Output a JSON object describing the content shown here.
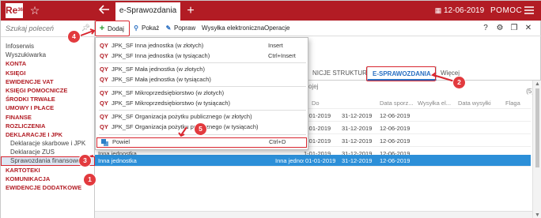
{
  "titlebar": {
    "logo": "Re",
    "logo_sup": "360",
    "active_tab": "e-Sprawozdania",
    "date": "12-06-2019",
    "help": "POMOC"
  },
  "sidebar": {
    "search_placeholder": "Szukaj poleceń",
    "items": [
      {
        "label": "Infoserwis",
        "style": "plain"
      },
      {
        "label": "Wyszukiwarka",
        "style": "plain"
      },
      {
        "label": "KONTA",
        "style": "red"
      },
      {
        "label": "KSIĘGI",
        "style": "red"
      },
      {
        "label": "EWIDENCJE VAT",
        "style": "red"
      },
      {
        "label": "KSIĘGI POMOCNICZE",
        "style": "red"
      },
      {
        "label": "ŚRODKI TRWAŁE",
        "style": "red"
      },
      {
        "label": "UMOWY I PŁACE",
        "style": "red"
      },
      {
        "label": "FINANSE",
        "style": "red"
      },
      {
        "label": "ROZLICZENIA",
        "style": "red"
      },
      {
        "label": "DEKLARACJE I JPK",
        "style": "red"
      },
      {
        "label": "Deklaracje skarbowe i JPK",
        "style": "sub"
      },
      {
        "label": "Deklaracje ZUS",
        "style": "sub"
      },
      {
        "label": "Sprawozdania finansowe",
        "style": "sub-sel"
      },
      {
        "label": "KARTOTEKI",
        "style": "red"
      },
      {
        "label": "KOMUNIKACJA",
        "style": "red"
      },
      {
        "label": "EWIDENCJE DODATKOWE",
        "style": "red"
      }
    ]
  },
  "toolbar": {
    "add": "Dodaj",
    "show": "Pokaż",
    "edit": "Popraw",
    "send": "Wysyłka elektroniczna",
    "ops": "Operacje",
    "help_icon": "?"
  },
  "tabs": {
    "structures": "NICJE STRUKTUR",
    "esprawozdania": "E-SPRAWOZDANIA",
    "more": "Więcej",
    "filter_fragment": "ojej",
    "count": "(5)"
  },
  "grid": {
    "headers": [
      "",
      "",
      "Do",
      "Data sporz...",
      "Wysyłka el...",
      "Data wysyłki",
      "Flaga"
    ],
    "rows": [
      {
        "a": "",
        "b": "1-01-2019",
        "do": "31-12-2019",
        "date": "12-06-2019",
        "selected": false
      },
      {
        "a": "",
        "b": "1-01-2019",
        "do": "31-12-2019",
        "date": "12-06-2019",
        "selected": false
      },
      {
        "a": "",
        "b": "1-01-2019",
        "do": "31-12-2019",
        "date": "12-06-2019",
        "selected": false
      },
      {
        "a": "Inna jednostka",
        "b": "1-01-2019",
        "do": "31-12-2019",
        "date": "12-06-2019",
        "selected": false
      },
      {
        "a": "Inna jednostka",
        "b": "Inna jednos...",
        "c": "01-01-2019",
        "do": "31-12-2019",
        "date": "12-06-2019",
        "selected": true
      }
    ]
  },
  "menu": {
    "items": [
      {
        "qy": "QY",
        "label": "JPK_SF Inna jednostka (w złotych)",
        "shortcut": "Insert"
      },
      {
        "qy": "QY",
        "label": "JPK_SF Inna jednostka (w tysiącach)",
        "shortcut": "Ctrl+Insert"
      },
      {
        "qy": "QY",
        "label": "JPK_SF Mała jednostka (w złotych)",
        "shortcut": ""
      },
      {
        "qy": "QY",
        "label": "JPK_SF Mała jednostka (w tysiącach)",
        "shortcut": ""
      },
      {
        "qy": "QY",
        "label": "JPK_SF Mikroprzedsiębiorstwo (w złotych)",
        "shortcut": ""
      },
      {
        "qy": "QY",
        "label": "JPK_SF Mikroprzedsiębiorstwo (w tysiącach)",
        "shortcut": ""
      },
      {
        "qy": "QY",
        "label": "JPK_SF Organizacja pożytku publicznego (w złotych)",
        "shortcut": ""
      },
      {
        "qy": "QY",
        "label": "JPK_SF Organizacja pożytku publicznego (w tysiącach)",
        "shortcut": ""
      }
    ],
    "duplicate": {
      "label": "Powiel",
      "shortcut": "Ctrl+D"
    }
  },
  "annotations": [
    "1",
    "2",
    "3",
    "4",
    "5"
  ],
  "colors": {
    "brand": "#b21c24",
    "accent": "#2a6fc2",
    "selection": "#2c8fd8",
    "annotation": "#e23a3e"
  }
}
